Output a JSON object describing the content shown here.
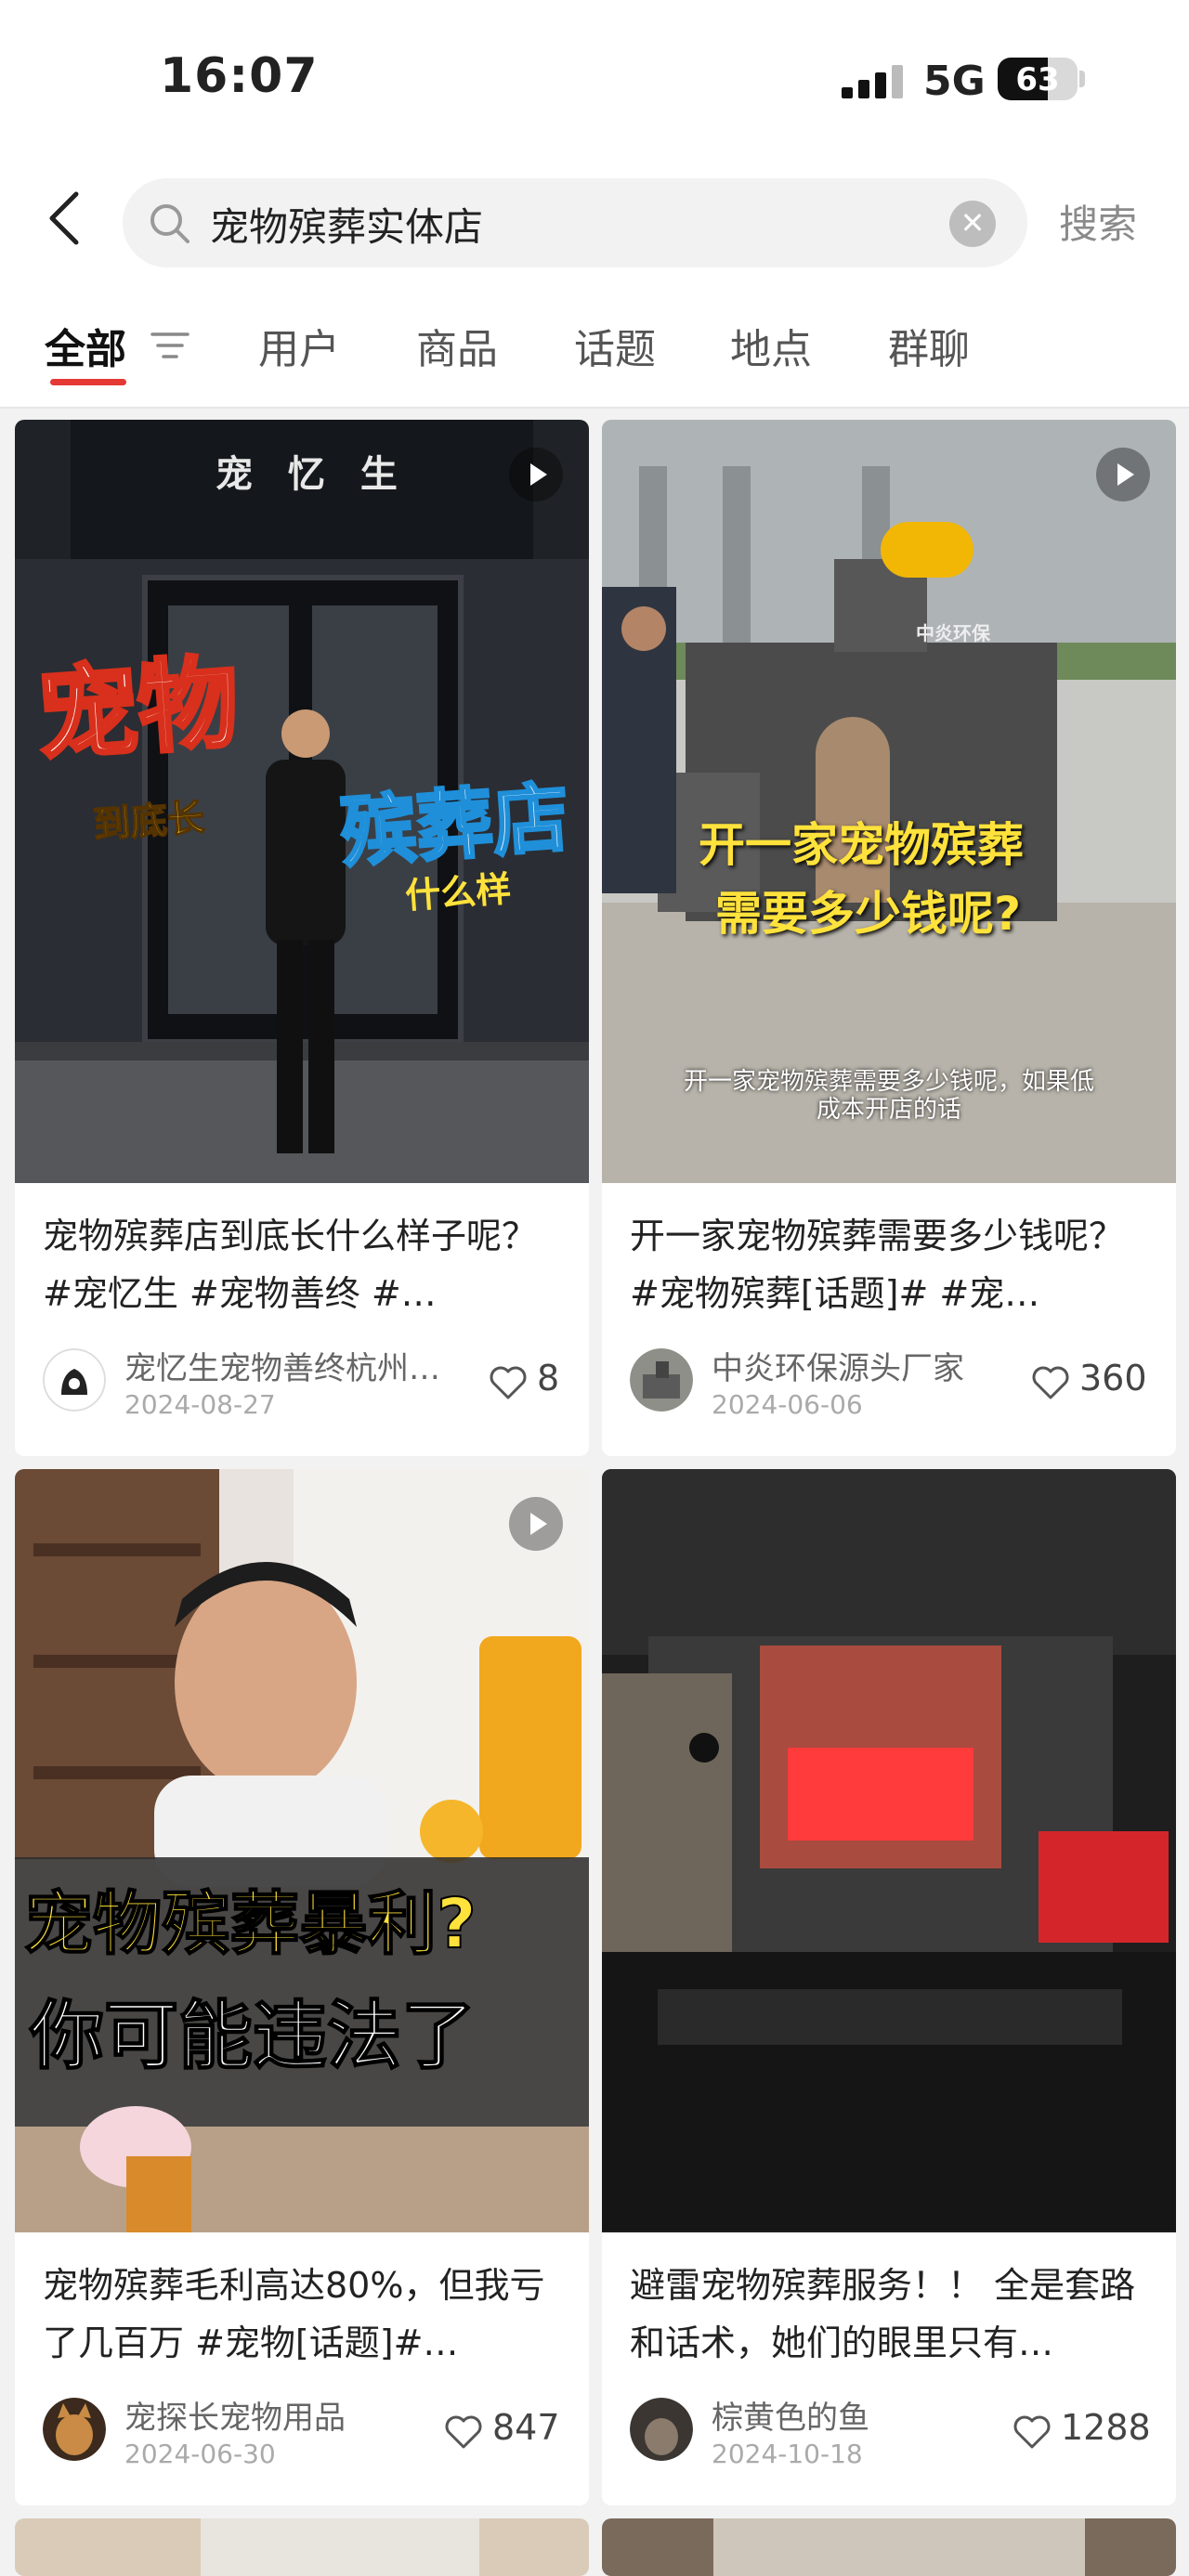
{
  "status": {
    "time": "16:07",
    "network": "5G",
    "battery": "63",
    "battery_level": 0.63
  },
  "search": {
    "query": "宠物殡葬实体店",
    "button_label": "搜索"
  },
  "tabs": [
    {
      "label": "全部",
      "active": true
    },
    {
      "label": "用户"
    },
    {
      "label": "商品"
    },
    {
      "label": "话题"
    },
    {
      "label": "地点"
    },
    {
      "label": "群聊"
    }
  ],
  "cards": [
    {
      "is_video": true,
      "image_text": {
        "sign": "宠 忆 生",
        "big1": "宠物",
        "small1": "到底长",
        "big2": "殡葬店",
        "small2": "什么样"
      },
      "title": "宠物殡葬店到底长什么样子呢？ #宠忆生 #宠物善终 #…",
      "author": "宠忆生宠物善终杭州…",
      "date": "2024-08-27",
      "likes": "8"
    },
    {
      "is_video": true,
      "image_text": {
        "logo": "中炎环保",
        "big1": "开一家宠物殡葬",
        "big2": "需要多少钱呢?",
        "subtitle1": "开一家宠物殡葬需要多少钱呢，如果低",
        "subtitle2": "成本开店的话"
      },
      "title": "开一家宠物殡葬需要多少钱呢？ #宠物殡葬[话题]# #宠…",
      "author": "中炎环保源头厂家",
      "date": "2024-06-06",
      "likes": "360"
    },
    {
      "is_video": true,
      "image_text": {
        "line1": "宠物殡葬暴利?",
        "line2": "你可能违法了"
      },
      "title": "宠物殡葬毛利高达80%，但我亏了几百万 #宠物[话题]#…",
      "author": "宠探长宠物用品",
      "date": "2024-06-30",
      "likes": "847"
    },
    {
      "is_video": false,
      "image_text": {},
      "title": "避雷宠物殡葬服务！！ 全是套路和话术，她们的眼里只有…",
      "author": "棕黄色的鱼",
      "date": "2024-10-18",
      "likes": "1288"
    }
  ],
  "colors": {
    "accent": "#e53935",
    "yellow_text": "#ffe23b",
    "background": "#f2f2f2"
  },
  "icons": [
    "back-arrow-icon",
    "search-icon",
    "clear-icon",
    "filter-icon",
    "play-icon",
    "heart-icon"
  ]
}
